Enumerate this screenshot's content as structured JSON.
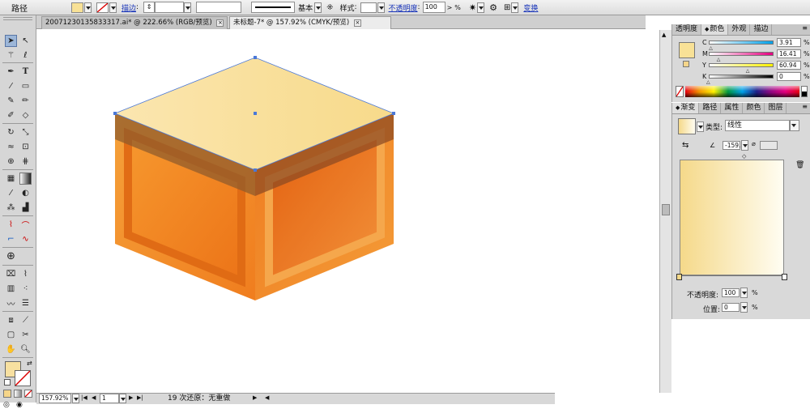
{
  "control_bar": {
    "object_type": "路径",
    "stroke_label": "描边",
    "stroke_profile_label": "基本",
    "style_label": "样式",
    "opacity_label": "不透明度",
    "opacity_value": "100",
    "opacity_unit": "%",
    "transform_label": "变换",
    "fill_color": "#f8e196"
  },
  "document_tabs": [
    {
      "label": "20071230135833317.ai* @ 222.66% (RGB/预览)",
      "active": false
    },
    {
      "label": "未标题-7* @ 157.92% (CMYK/预览)",
      "active": true
    }
  ],
  "status_bar": {
    "zoom": "157.92%",
    "page": "1",
    "undo_info": "19 次还原：无重做"
  },
  "color_panel": {
    "tabs": [
      "透明度",
      "颜色",
      "外观",
      "描边"
    ],
    "active_tab": "颜色",
    "channels": [
      {
        "name": "C",
        "value": "3.91",
        "fraction": 0.04,
        "gradient": "linear-gradient(90deg,#ffffff,#00a0e9)"
      },
      {
        "name": "M",
        "value": "16.41",
        "fraction": 0.16,
        "gradient": "linear-gradient(90deg,#ffffff,#e4007f)"
      },
      {
        "name": "Y",
        "value": "60.94",
        "fraction": 0.61,
        "gradient": "linear-gradient(90deg,#ffffff,#fff100)"
      },
      {
        "name": "K",
        "value": "0",
        "fraction": 0.0,
        "gradient": "linear-gradient(90deg,#ffffff,#000000)"
      }
    ],
    "channel_unit": "%",
    "swatch": "#f8e196"
  },
  "gradient_panel": {
    "tabs": [
      "渐变",
      "路径",
      "属性",
      "颜色",
      "图层"
    ],
    "active_tab": "渐变",
    "type_label": "类型:",
    "type_value": "线性",
    "angle_value": "-159.",
    "gradient_start": "#f5d98a",
    "gradient_end": "#fffdf2",
    "opacity_label": "不透明度:",
    "opacity_value": "100",
    "position_label": "位置:",
    "position_value": "0",
    "unit": "%"
  },
  "toolbox": {
    "fill_color": "#f7e0a0",
    "icons": [
      "selection-icon",
      "direct-selection-icon",
      "magic-wand-icon",
      "lasso-icon",
      "pen-icon",
      "type-icon",
      "line-icon",
      "rectangle-icon",
      "paintbrush-icon",
      "pencil-icon",
      "blob-brush-icon",
      "eraser-icon",
      "rotate-icon",
      "scale-icon",
      "warp-icon",
      "free-transform-icon",
      "symbol-sprayer-icon",
      "column-graph-icon",
      "mesh-icon",
      "gradient-icon",
      "eyedropper-icon",
      "blend-icon",
      "live-paint-icon",
      "slice-icon",
      "artboard-icon",
      "hand-icon",
      "zoom-icon"
    ]
  }
}
